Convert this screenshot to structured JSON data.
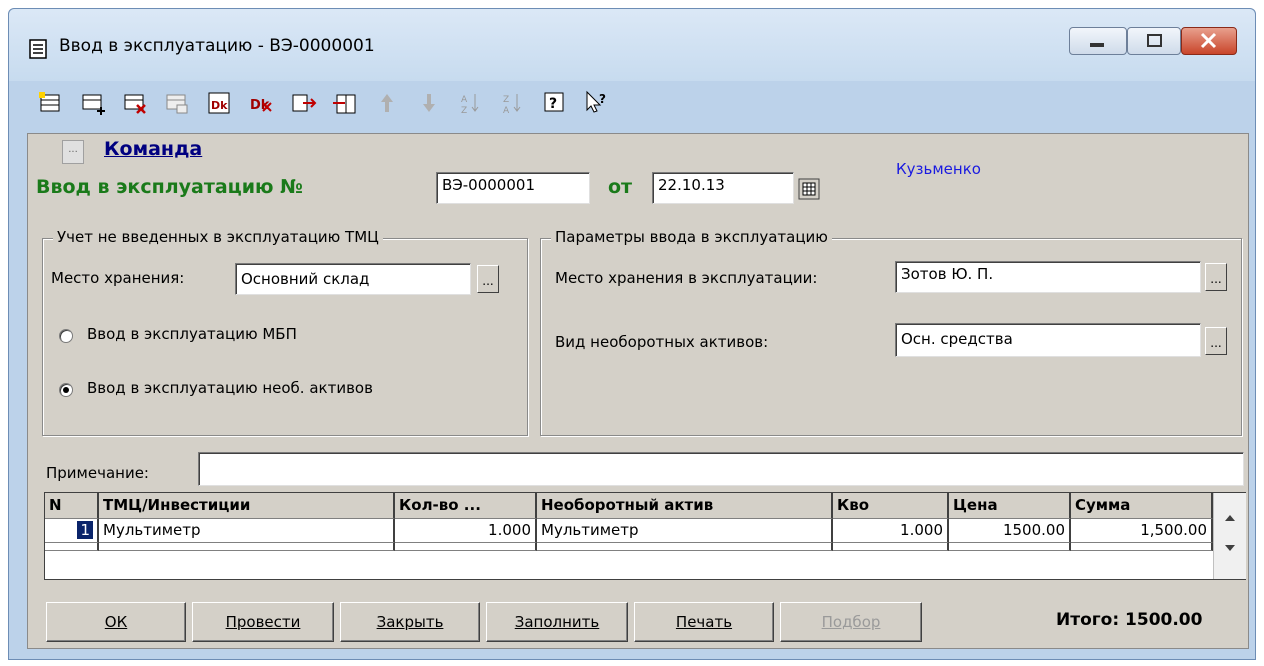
{
  "window": {
    "title": "Ввод в эксплуатацию - ВЭ-0000001"
  },
  "command_link": "Команда",
  "doc": {
    "heading": "Ввод в эксплуатацию №",
    "number": "ВЭ-0000001",
    "date_label": "от",
    "date": "22.10.13",
    "author": "Кузьменко"
  },
  "left_group": {
    "title": "Учет не введенных в эксплуатацию ТМЦ",
    "storage_label": "Место хранения:",
    "storage_value": "Основний склад",
    "radio_mbp": "Ввод в эксплуатацию МБП",
    "radio_assets": "Ввод в эксплуатацию необ. активов"
  },
  "right_group": {
    "title": "Параметры ввода в эксплуатацию",
    "storage_label": "Место хранения в эксплуатации:",
    "storage_value": "Зотов Ю. П.",
    "kind_label": "Вид необоротных активов:",
    "kind_value": "Осн. средства"
  },
  "note": {
    "label": "Примечание:",
    "value": ""
  },
  "table": {
    "columns": [
      "N",
      "ТМЦ/Инвестиции",
      "Кол-во ...",
      "Необоротный актив",
      "Кво",
      "Цена",
      "Сумма"
    ],
    "rows": [
      [
        "1",
        "Мультиметр",
        "1.000",
        "Мультиметр",
        "1.000",
        "1500.00",
        "1,500.00"
      ]
    ]
  },
  "buttons": {
    "ok": "ОК",
    "post": "Провести",
    "close": "Закрыть",
    "fill": "Заполнить",
    "print": "Печать",
    "pick": "Подбор"
  },
  "total": "Итого: 1500.00",
  "colors": {
    "heading_green": "#1a7a1a",
    "author_blue": "#1a1ae0",
    "link_navy": "#000080"
  }
}
